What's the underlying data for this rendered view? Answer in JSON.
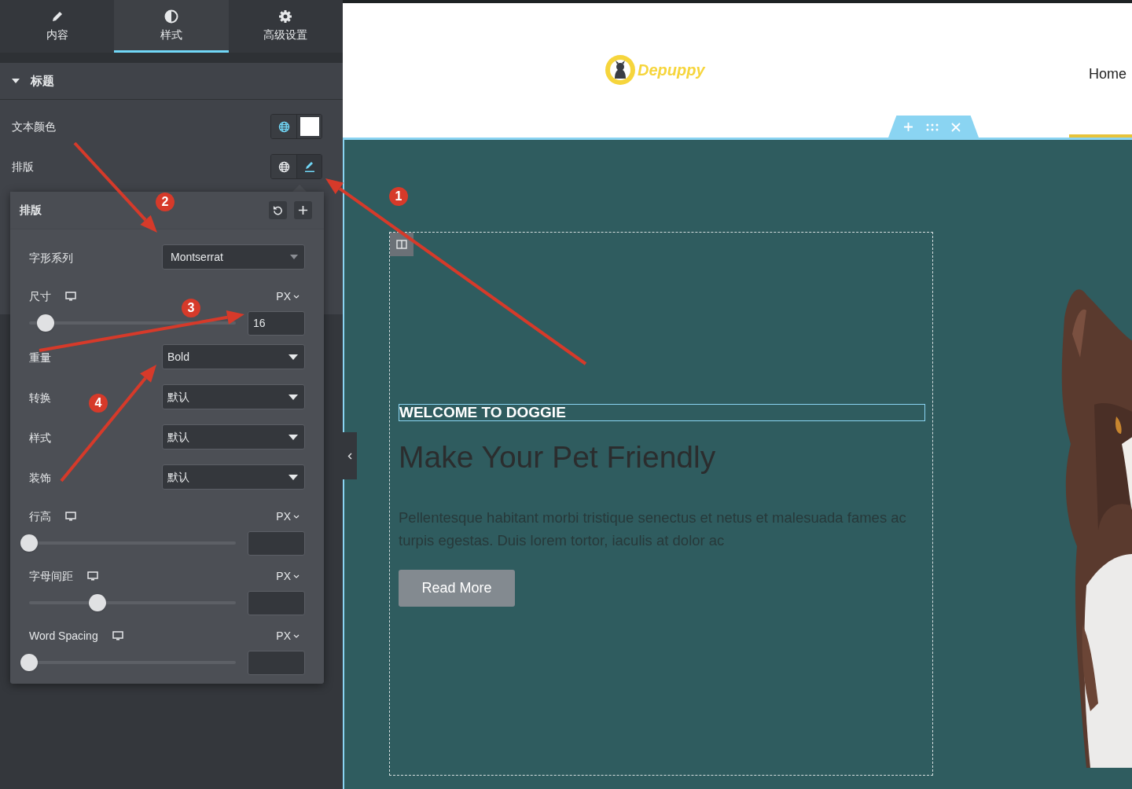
{
  "editor_panel": {
    "tabs": [
      {
        "label": "内容",
        "selected": false
      },
      {
        "label": "样式",
        "selected": true
      },
      {
        "label": "高级设置",
        "selected": false
      }
    ],
    "section": {
      "title": "标题",
      "expanded": true
    },
    "controls": [
      {
        "kind": "color",
        "label": "文本颜色"
      },
      {
        "kind": "typography",
        "label": "排版"
      }
    ],
    "typography_popover": {
      "title": "排版",
      "rows": [
        {
          "kind": "select",
          "label": "字形系列",
          "value": "Montserrat"
        },
        {
          "kind": "slider",
          "label": "尺寸",
          "unit": "PX",
          "level": 0.08,
          "value": "16"
        },
        {
          "kind": "select",
          "label": "重量",
          "value": "Bold"
        },
        {
          "kind": "select",
          "label": "转换",
          "value": "默认"
        },
        {
          "kind": "select",
          "label": "样式",
          "value": "默认"
        },
        {
          "kind": "select",
          "label": "装饰",
          "value": "默认"
        },
        {
          "kind": "slider",
          "label": "行高",
          "unit": "PX",
          "level": 0
        },
        {
          "kind": "slider",
          "label": "字母间距",
          "unit": "PX",
          "level": 0.33
        },
        {
          "kind": "slider",
          "label": "Word Spacing",
          "unit": "PX",
          "level": 0
        }
      ]
    }
  },
  "preview": {
    "logo_text": "Depuppy",
    "nav_item": "Home",
    "subheading": "WELCOME TO DOGGIE",
    "heading": "Make Your Pet Friendly",
    "paragraph": "Pellentesque habitant morbi tristique senectus et netus et malesuada fames ac turpis egestas. Duis lorem tortor, iaculis at dolor ac",
    "button": "Read More"
  },
  "annotations": [
    {
      "number": "1"
    },
    {
      "number": "2"
    },
    {
      "number": "3"
    },
    {
      "number": "4"
    }
  ]
}
